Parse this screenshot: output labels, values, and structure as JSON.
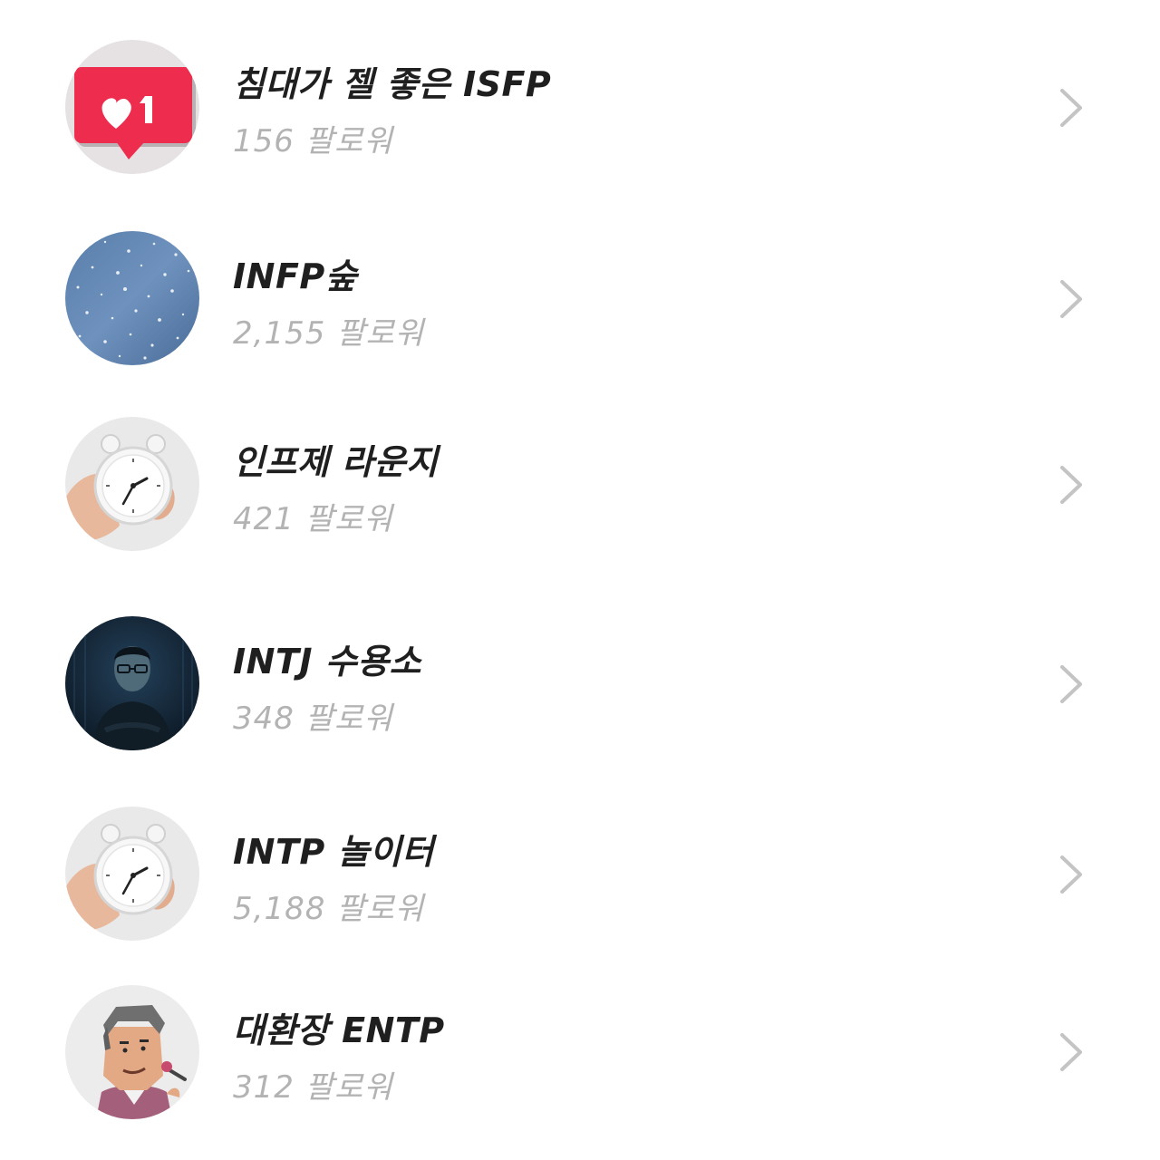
{
  "rooms": [
    {
      "name": "침대가 젤 좋은 ISFP",
      "followers": "156",
      "followers_label": "팔로워",
      "avatar_icon": "like-notification-icon"
    },
    {
      "name": "INFP숲",
      "followers": "2,155",
      "followers_label": "팔로워",
      "avatar_icon": "sparkling-water-image"
    },
    {
      "name": "인프제 라운지",
      "followers": "421",
      "followers_label": "팔로워",
      "avatar_icon": "alarm-clock-in-hand-image"
    },
    {
      "name": "INTJ 수용소",
      "followers": "348",
      "followers_label": "팔로워",
      "avatar_icon": "man-in-glasses-dark-image"
    },
    {
      "name": "INTP 놀이터",
      "followers": "5,188",
      "followers_label": "팔로워",
      "avatar_icon": "alarm-clock-in-hand-image"
    },
    {
      "name": "대환장 ENTP",
      "followers": "312",
      "followers_label": "팔로워",
      "avatar_icon": "cartoon-man-with-microphone-image"
    }
  ],
  "colors": {
    "title": "#1f1f1f",
    "followers": "#b3b3b3",
    "chevron": "#c4c4c4",
    "like_badge": "#ef2d4f"
  }
}
